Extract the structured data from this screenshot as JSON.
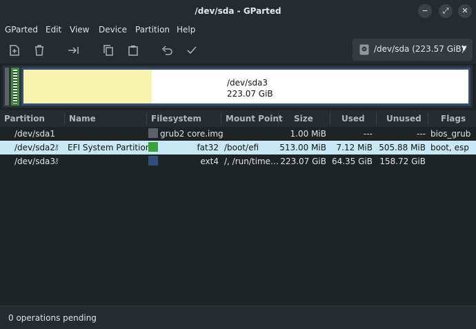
{
  "window": {
    "title": "/dev/sda - GParted"
  },
  "menu": [
    "GParted",
    "Edit",
    "View",
    "Device",
    "Partition",
    "Help"
  ],
  "toolbar": {
    "icons": [
      "new-partition-icon",
      "delete-icon",
      "resize-move-icon",
      "copy-icon",
      "paste-icon",
      "undo-icon",
      "apply-icon"
    ]
  },
  "device": {
    "label": "/dev/sda  (223.57 GiB)"
  },
  "disk_map": {
    "partition": "/dev/sda3",
    "size": "223.07 GiB"
  },
  "table": {
    "headers": [
      "Partition",
      "Name",
      "Filesystem",
      "Mount Point",
      "Size",
      "Used",
      "Unused",
      "Flags"
    ],
    "rows": [
      {
        "partition": "/dev/sda1",
        "name": "",
        "filesystem": "grub2 core.img",
        "fs_color": "#5c6165",
        "mount": "",
        "size": "1.00 MiB",
        "used": "---",
        "unused": "---",
        "flags": "bios_grub",
        "locked": false,
        "selected": false
      },
      {
        "partition": "/dev/sda2",
        "name": "EFI System Partition",
        "filesystem": "fat32",
        "fs_color": "#3aa33a",
        "mount": "/boot/efi",
        "size": "513.00 MiB",
        "used": "7.12 MiB",
        "unused": "505.88 MiB",
        "flags": "boot, esp",
        "locked": true,
        "selected": true
      },
      {
        "partition": "/dev/sda3",
        "name": "",
        "filesystem": "ext4",
        "fs_color": "#2f4f78",
        "mount": "/, /run/time…",
        "size": "223.07 GiB",
        "used": "64.35 GiB",
        "unused": "158.72 GiB",
        "flags": "",
        "locked": true,
        "selected": false
      }
    ]
  },
  "status": "0 operations pending"
}
